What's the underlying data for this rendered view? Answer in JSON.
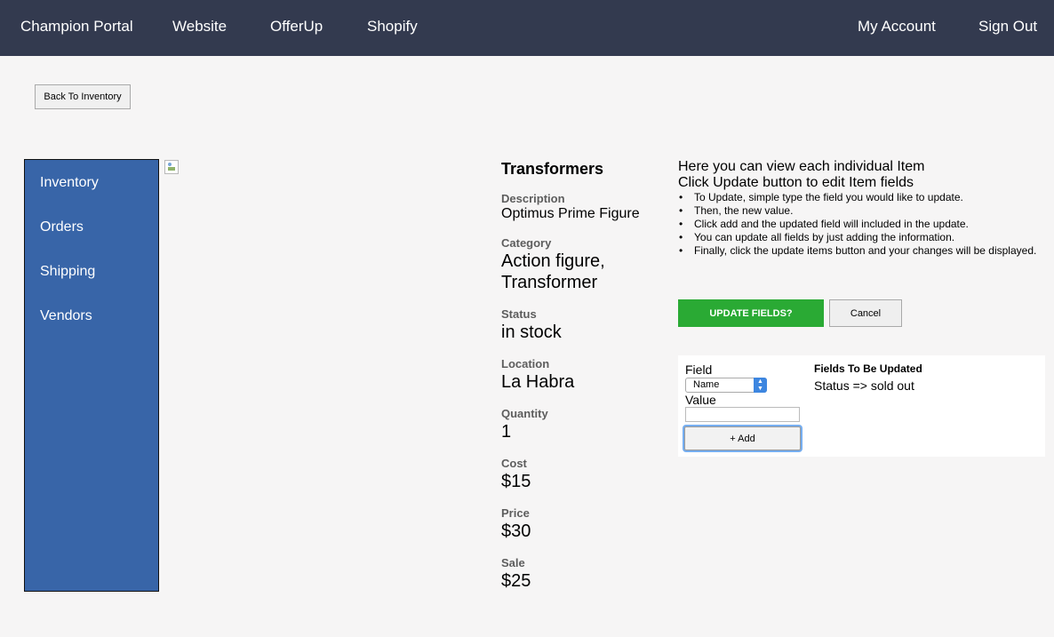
{
  "nav": {
    "brand": "Champion Portal",
    "links": [
      "Website",
      "OfferUp",
      "Shopify"
    ],
    "account": "My Account",
    "signout": "Sign Out"
  },
  "back_button": "Back To Inventory",
  "sidebar": {
    "items": [
      "Inventory",
      "Orders",
      "Shipping",
      "Vendors"
    ]
  },
  "item": {
    "title": "Transformers",
    "fields": [
      {
        "label": "Description",
        "value": "Optimus Prime Figure"
      },
      {
        "label": "Category",
        "value": "Action figure, Transformer",
        "value_line1": "Action figure,",
        "value_line2": "Transformer"
      },
      {
        "label": "Status",
        "value": "in stock"
      },
      {
        "label": "Location",
        "value": "La Habra"
      },
      {
        "label": "Quantity",
        "value": "1"
      },
      {
        "label": "Cost",
        "value": "$15"
      },
      {
        "label": "Price",
        "value": "$30"
      },
      {
        "label": "Sale",
        "value": "$25"
      }
    ]
  },
  "help": {
    "line1": "Here you can view each individual Item",
    "line2": "Click Update button to edit Item fields",
    "bullets": [
      "To Update, simple type the field you would like to update.",
      "Then, the new value.",
      "Click add and the updated field will included in the update.",
      "You can update all fields by just adding the information.",
      "Finally, click the update items button and your changes will be displayed."
    ]
  },
  "actions": {
    "update": "UPDATE FIELDS?",
    "cancel": "Cancel"
  },
  "update_panel": {
    "field_label": "Field",
    "field_selected": "Name",
    "value_label": "Value",
    "value_current": "",
    "add_button": "+ Add",
    "list_title": "Fields To Be Updated",
    "pending": [
      "Status => sold out"
    ]
  },
  "colors": {
    "navbar": "#333a4f",
    "sidebar": "#3865a8",
    "update_button": "#2aaa34"
  }
}
